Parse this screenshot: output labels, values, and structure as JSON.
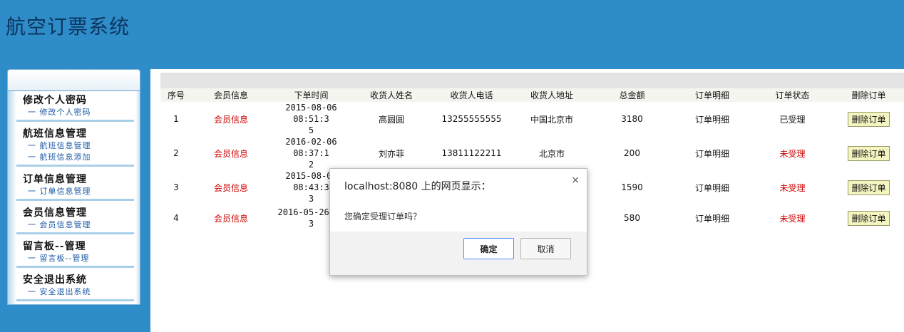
{
  "app": {
    "title": "航空订票系统"
  },
  "sidebar": {
    "groups": [
      {
        "title": "修改个人密码",
        "items": [
          "一 修改个人密码"
        ]
      },
      {
        "title": "航班信息管理",
        "items": [
          "一 航班信息管理",
          "一 航班信息添加"
        ]
      },
      {
        "title": "订单信息管理",
        "items": [
          "一 订单信息管理"
        ]
      },
      {
        "title": "会员信息管理",
        "items": [
          "一 会员信息管理"
        ]
      },
      {
        "title": "留言板--管理",
        "items": [
          "一 留言板--管理"
        ]
      },
      {
        "title": "安全退出系统",
        "items": [
          "一 安全退出系统"
        ]
      }
    ]
  },
  "table": {
    "headers": [
      "序号",
      "会员信息",
      "下单时间",
      "收货人姓名",
      "收货人电话",
      "收货人地址",
      "总金额",
      "订单明细",
      "订单状态",
      "删除订单"
    ],
    "rows": [
      {
        "no": "1",
        "member": "会员信息",
        "time1": "2015-08-06 08:51:3",
        "time2": "5",
        "name": "高圆圆",
        "phone": "13255555555",
        "address": "中国北京市",
        "amount": "3180",
        "detail": "订单明细",
        "status": "已受理",
        "del": "删除订单"
      },
      {
        "no": "2",
        "member": "会员信息",
        "time1": "2016-02-06 08:37:1",
        "time2": "2",
        "name": "刘亦菲",
        "phone": "13811122211",
        "address": "北京市",
        "amount": "200",
        "detail": "订单明细",
        "status": "未受理",
        "del": "删除订单"
      },
      {
        "no": "3",
        "member": "会员信息",
        "time1": "2015-08-06 08:43:3",
        "time2": "3",
        "name": "",
        "phone": "",
        "address": "",
        "amount": "1590",
        "detail": "订单明细",
        "status": "未受理",
        "del": "删除订单"
      },
      {
        "no": "4",
        "member": "会员信息",
        "time1": "2016-05-26 01",
        "time2": "3",
        "name": "",
        "phone": "",
        "address": "",
        "amount": "580",
        "detail": "订单明细",
        "status": "未受理",
        "del": "删除订单"
      }
    ]
  },
  "dialog": {
    "title": "localhost:8080 上的网页显示：",
    "close": "×",
    "message": "您确定受理订单吗？",
    "ok": "确定",
    "cancel": "取消"
  },
  "colors": {
    "header_bg": "#2e8cc8",
    "status_red": "#d00000"
  }
}
